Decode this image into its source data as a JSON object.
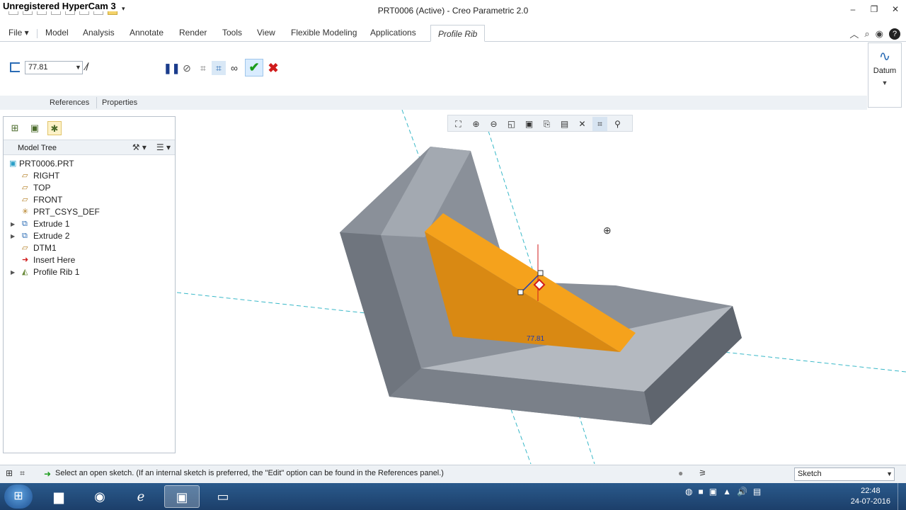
{
  "window": {
    "watermark": "Unregistered HyperCam 3",
    "title": "PRT0006 (Active) - Creo Parametric 2.0",
    "controls": [
      "–",
      "❐",
      "✕"
    ]
  },
  "menu": {
    "file": "File ▾",
    "tabs": [
      "Model",
      "Analysis",
      "Annotate",
      "Render",
      "Tools",
      "View",
      "Flexible Modeling",
      "Applications"
    ],
    "active_tab": "Profile Rib"
  },
  "dashboard": {
    "thickness_value": "77.81",
    "references_tab": "References",
    "properties_tab": "Properties"
  },
  "datum": {
    "label": "Datum"
  },
  "model_tree": {
    "title": "Model Tree",
    "items": [
      {
        "label": "PRT0006.PRT",
        "icon": "part-icon",
        "expandable": false,
        "indent": 0
      },
      {
        "label": "RIGHT",
        "icon": "datum-plane-icon",
        "expandable": false,
        "indent": 1
      },
      {
        "label": "TOP",
        "icon": "datum-plane-icon",
        "expandable": false,
        "indent": 1
      },
      {
        "label": "FRONT",
        "icon": "datum-plane-icon",
        "expandable": false,
        "indent": 1
      },
      {
        "label": "PRT_CSYS_DEF",
        "icon": "csys-icon",
        "expandable": false,
        "indent": 1
      },
      {
        "label": "Extrude 1",
        "icon": "extrude-icon",
        "expandable": true,
        "indent": 1
      },
      {
        "label": "Extrude 2",
        "icon": "extrude-icon",
        "expandable": true,
        "indent": 1
      },
      {
        "label": "DTM1",
        "icon": "datum-plane-icon",
        "expandable": false,
        "indent": 1
      },
      {
        "label": "Insert Here",
        "icon": "insert-arrow-icon",
        "expandable": false,
        "indent": 1
      },
      {
        "label": "Profile Rib 1",
        "icon": "rib-icon",
        "expandable": true,
        "indent": 1
      }
    ]
  },
  "scene": {
    "dimension_label": "77.81"
  },
  "status": {
    "message": "Select an open sketch. (If an internal sketch is preferred, the \"Edit\" option can be found in the References panel.)",
    "filter": "Sketch"
  },
  "taskbar": {
    "time": "22:48",
    "date": "24-07-2016"
  },
  "colors": {
    "rib_fill": "#f5a21c",
    "body_fill": "#8a9099",
    "accent_blue": "#2b6cb5"
  }
}
